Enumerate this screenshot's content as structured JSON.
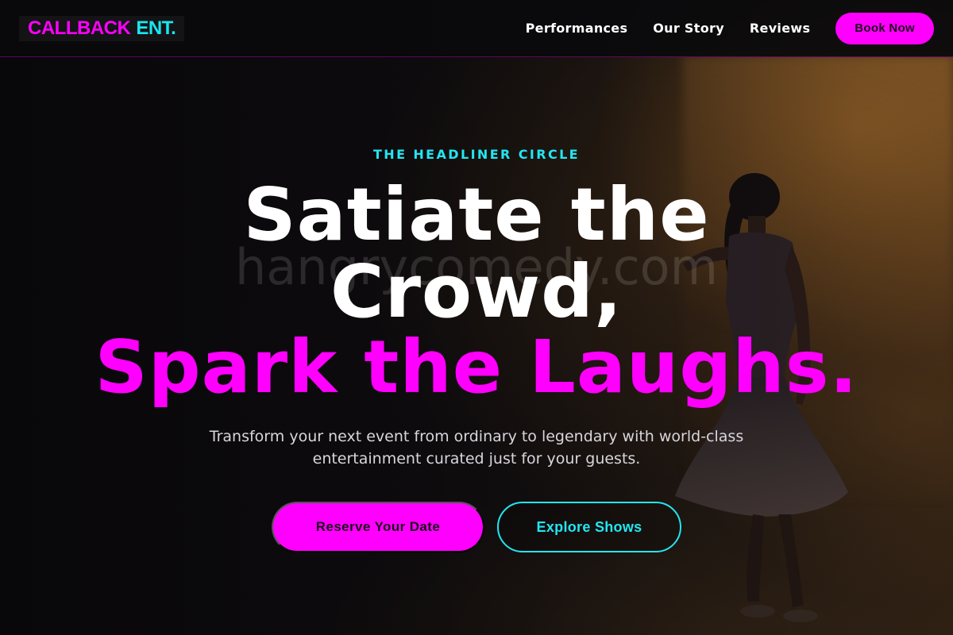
{
  "header": {
    "logo": {
      "part1": "CALLBACK",
      "part2": "ENT."
    },
    "nav": {
      "items": [
        {
          "label": "Performances"
        },
        {
          "label": "Our Story"
        },
        {
          "label": "Reviews"
        }
      ],
      "cta_label": "Book Now"
    }
  },
  "hero": {
    "eyebrow": "THE HEADLINER CIRCLE",
    "headline_line1": "Satiate the",
    "headline_line2": "Crowd,",
    "headline_accent": "Spark the Laughs.",
    "watermark": "hangrycomedy.com",
    "subtext": "Transform your next event from ordinary to legendary with world-class entertainment curated just for your guests.",
    "primary_cta": "Reserve Your Date",
    "secondary_cta": "Explore Shows",
    "image": {
      "subject": "performer-silhouette-on-stage"
    }
  },
  "colors": {
    "accent_magenta": "#ff00ff",
    "accent_cyan": "#22e6f2",
    "header_bg": "#0a0a0c"
  }
}
